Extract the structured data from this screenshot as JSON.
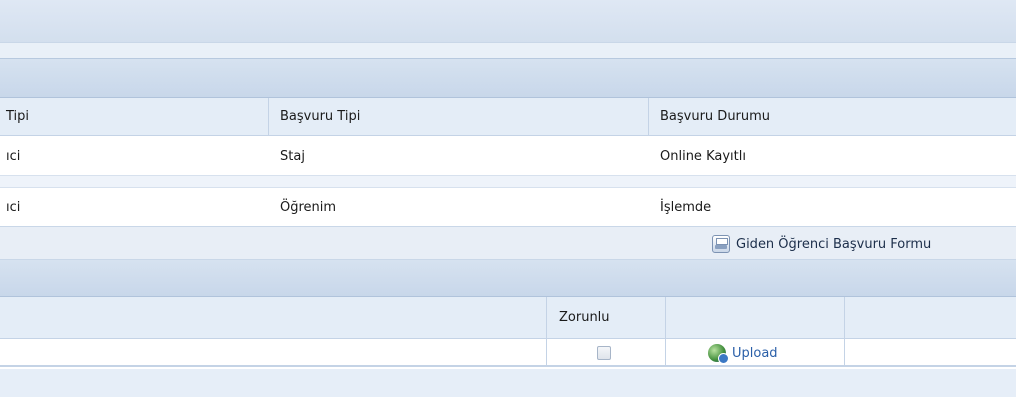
{
  "applications_table": {
    "columns": [
      "Tipi",
      "Başvuru Tipi",
      "Başvuru Durumu"
    ],
    "rows": [
      {
        "type_fragment": "ıci",
        "application_type": "Staj",
        "status": "Online Kayıtlı"
      },
      {
        "type_fragment": "ıci",
        "application_type": "Öğrenim",
        "status": "İşlemde"
      }
    ]
  },
  "form_button": {
    "label": "Giden Öğrenci Başvuru Formu",
    "icon": "printer-icon"
  },
  "documents_table": {
    "columns": [
      "",
      "Zorunlu",
      "",
      ""
    ],
    "rows": [
      {
        "required": false,
        "upload_label": "Upload",
        "upload_icon": "globe-upload-icon"
      }
    ]
  },
  "colors": {
    "header_band": "#d3dfee",
    "table_header": "#e4edf7",
    "link": "#2a5fa8"
  }
}
